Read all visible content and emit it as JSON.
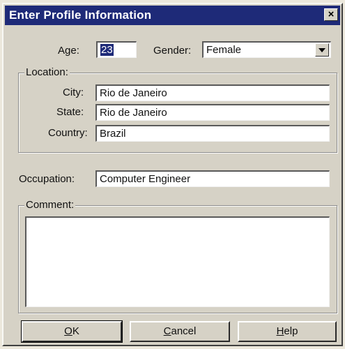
{
  "window": {
    "title": "Enter Profile Information",
    "close_glyph": "×"
  },
  "fields": {
    "age": {
      "label": "Age:",
      "value": "23"
    },
    "gender": {
      "label": "Gender:",
      "value": "Female"
    },
    "location_group": "Location:",
    "city": {
      "label": "City:",
      "value": "Rio de Janeiro"
    },
    "state": {
      "label": "State:",
      "value": "Rio de Janeiro"
    },
    "country": {
      "label": "Country:",
      "value": "Brazil"
    },
    "occupation": {
      "label": "Occupation:",
      "value": "Computer Engineer"
    },
    "comment_group": "Comment:",
    "comment": {
      "value": ""
    }
  },
  "buttons": {
    "ok": {
      "mnemonic": "O",
      "rest": "K"
    },
    "cancel": {
      "mnemonic": "C",
      "rest": "ancel"
    },
    "help": {
      "mnemonic": "H",
      "rest": "elp"
    }
  },
  "colors": {
    "titlebar": "#1e2a78",
    "dialog_face": "#d6d2c6",
    "selection": "#1e2a78"
  },
  "icons": {
    "close": "close-icon",
    "dropdown": "chevron-down-icon"
  }
}
